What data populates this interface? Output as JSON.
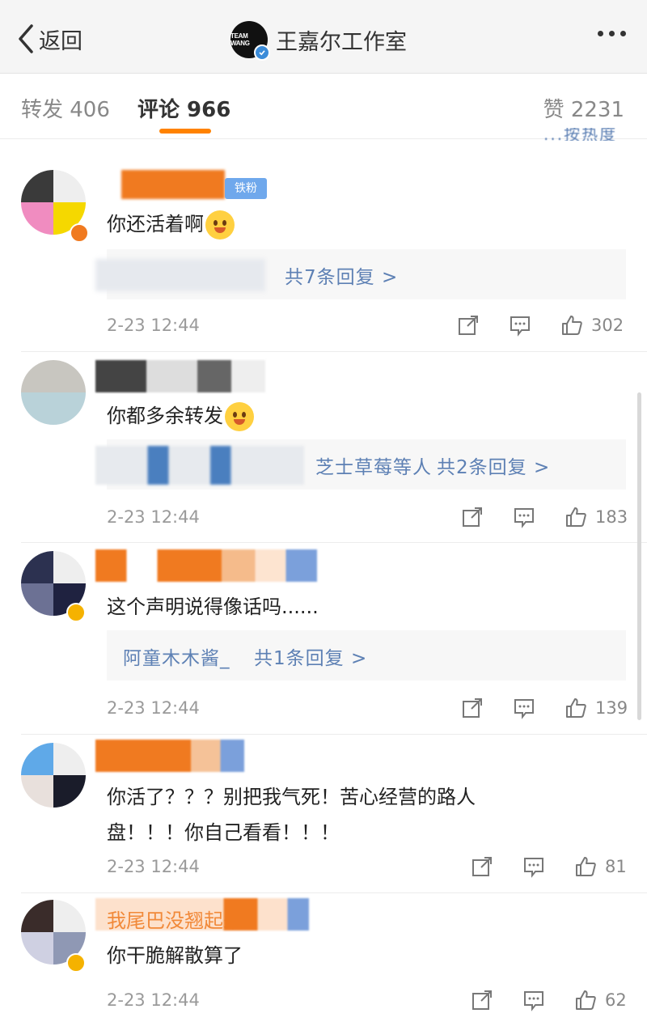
{
  "nav": {
    "back_label": "返回",
    "logo_text": "TEAM WANG",
    "title": "王嘉尔工作室"
  },
  "tabs": {
    "repost": "转发 406",
    "comment": "评论 966",
    "like": "赞 2231"
  },
  "partial_text": "...按热度",
  "comments": [
    {
      "text": "你还活着啊",
      "emoji": "laughing-face-icon",
      "reply_summary": "共7条回复 >",
      "time": "2-23 12:44",
      "likes": "302"
    },
    {
      "text": "你都多余转发",
      "emoji": "sweat-smile-icon",
      "reply_preview": "芝士草莓等人",
      "reply_summary": "共2条回复 >",
      "time": "2-23 12:44",
      "likes": "183"
    },
    {
      "text": "这个声明说得像话吗......",
      "reply_preview": "阿童木木酱_",
      "reply_summary": "共1条回复 >",
      "time": "2-23 12:44",
      "likes": "139"
    },
    {
      "text_line1": "你活了？？？别把我气死！苦心经营的路人",
      "text_line2": "盘！！！你自己看看！！！",
      "time": "2-23 12:44",
      "likes": "81"
    },
    {
      "name": "我尾巴没翘起来",
      "text": "你干脆解散算了",
      "time": "2-23 12:44",
      "likes": "62"
    }
  ],
  "badges": {
    "fan": "铁粉"
  },
  "colors": {
    "accent": "#ff8200",
    "link": "#5d80b4",
    "verified": "#f5b200",
    "blue_verified": "#3b8cd9"
  }
}
